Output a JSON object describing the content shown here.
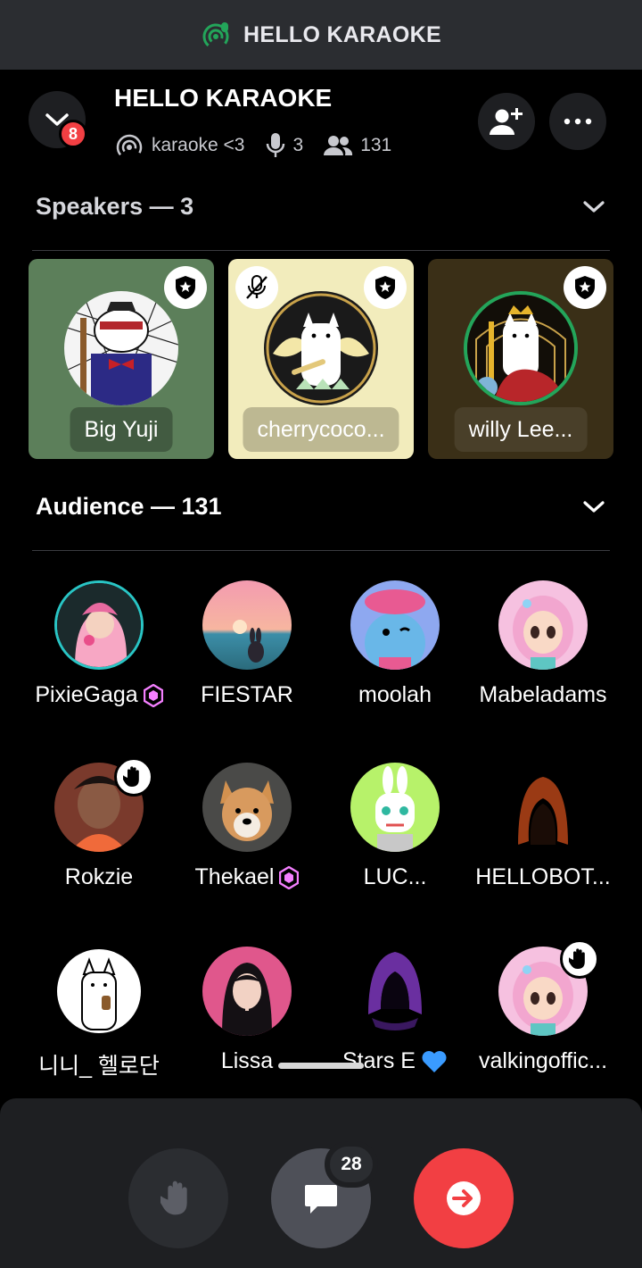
{
  "topbar": {
    "title": "HELLO KARAOKE"
  },
  "header": {
    "title": "HELLO KARAOKE",
    "notification_count": "8",
    "topic": "karaoke <3",
    "speaker_count": "3",
    "listener_count": "131"
  },
  "speakers": {
    "heading": "Speakers — 3",
    "items": [
      {
        "name": "Big Yuji",
        "bg": "#5c7f5a",
        "moderator": true,
        "muted": false
      },
      {
        "name": "cherrycoco...",
        "bg": "#f2ecbc",
        "moderator": true,
        "muted": true
      },
      {
        "name": "willy Lee...",
        "bg": "#3a2f17",
        "moderator": true,
        "muted": false
      }
    ]
  },
  "audience": {
    "heading": "Audience — 131",
    "rows": [
      [
        "PixieGaga",
        "FIESTAR",
        "moolah",
        "Mabeladams"
      ],
      [
        "Rokzie",
        "Thekael",
        "LUC...",
        "HELLOBOT..."
      ],
      [
        "니니_ 헬로단",
        "Lissa",
        "Stars E",
        "valkingoffic..."
      ]
    ]
  },
  "controls": {
    "chat_count": "28"
  },
  "colors": {
    "accent_red": "#f23f43",
    "nitro_pink": "#f47fff",
    "heart_blue": "#3a9bff",
    "speaking_green": "#23a55a"
  },
  "icons": [
    "stage-icon",
    "chevron-down-icon",
    "add-user-icon",
    "more-icon",
    "stage-topic-icon",
    "microphone-icon",
    "people-icon",
    "moderator-shield-icon",
    "mic-muted-icon",
    "nitro-boost-icon",
    "raised-hand-icon",
    "blue-heart-icon",
    "chat-icon",
    "leave-icon"
  ]
}
